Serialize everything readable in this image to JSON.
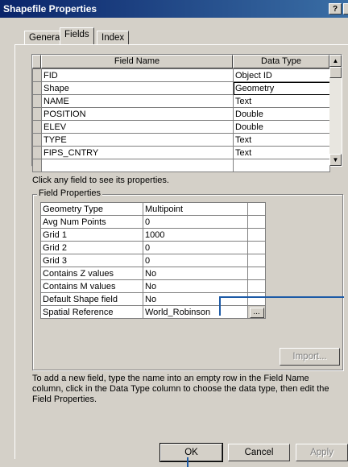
{
  "window": {
    "title": "Shapefile Properties",
    "help_btn": "?"
  },
  "tabs": [
    {
      "label": "General"
    },
    {
      "label": "Fields"
    },
    {
      "label": "Index"
    }
  ],
  "fields_table": {
    "headers": [
      "Field Name",
      "Data Type"
    ],
    "rows": [
      {
        "name": "FID",
        "type": "Object ID"
      },
      {
        "name": "Shape",
        "type": "Geometry"
      },
      {
        "name": "NAME",
        "type": "Text"
      },
      {
        "name": "POSITION",
        "type": "Double"
      },
      {
        "name": "ELEV",
        "type": "Double"
      },
      {
        "name": "TYPE",
        "type": "Text"
      },
      {
        "name": "FIPS_CNTRY",
        "type": "Text"
      },
      {
        "name": "",
        "type": ""
      }
    ]
  },
  "hint_text": "Click any field to see its properties.",
  "field_properties": {
    "label": "Field Properties",
    "rows": [
      {
        "name": "Geometry Type",
        "value": "Multipoint"
      },
      {
        "name": "Avg Num Points",
        "value": "0"
      },
      {
        "name": "Grid 1",
        "value": "1000"
      },
      {
        "name": "Grid 2",
        "value": "0"
      },
      {
        "name": "Grid 3",
        "value": "0"
      },
      {
        "name": "Contains Z values",
        "value": "No"
      },
      {
        "name": "Contains M values",
        "value": "No"
      },
      {
        "name": "Default Shape field",
        "value": "No"
      },
      {
        "name": "Spatial Reference",
        "value": "World_Robinson"
      }
    ],
    "ellipsis": "...",
    "import_label": "Import..."
  },
  "instructions": "To add a new field, type the name into an empty row in the Field Name column, click in the Data Type column to choose the data type, then edit the Field Properties.",
  "buttons": {
    "ok": "OK",
    "cancel": "Cancel",
    "apply": "Apply"
  },
  "colors": {
    "title_start": "#0a246a",
    "title_end": "#3a6ea5",
    "callout": "#1c5aa6",
    "face": "#d4d0c8"
  }
}
